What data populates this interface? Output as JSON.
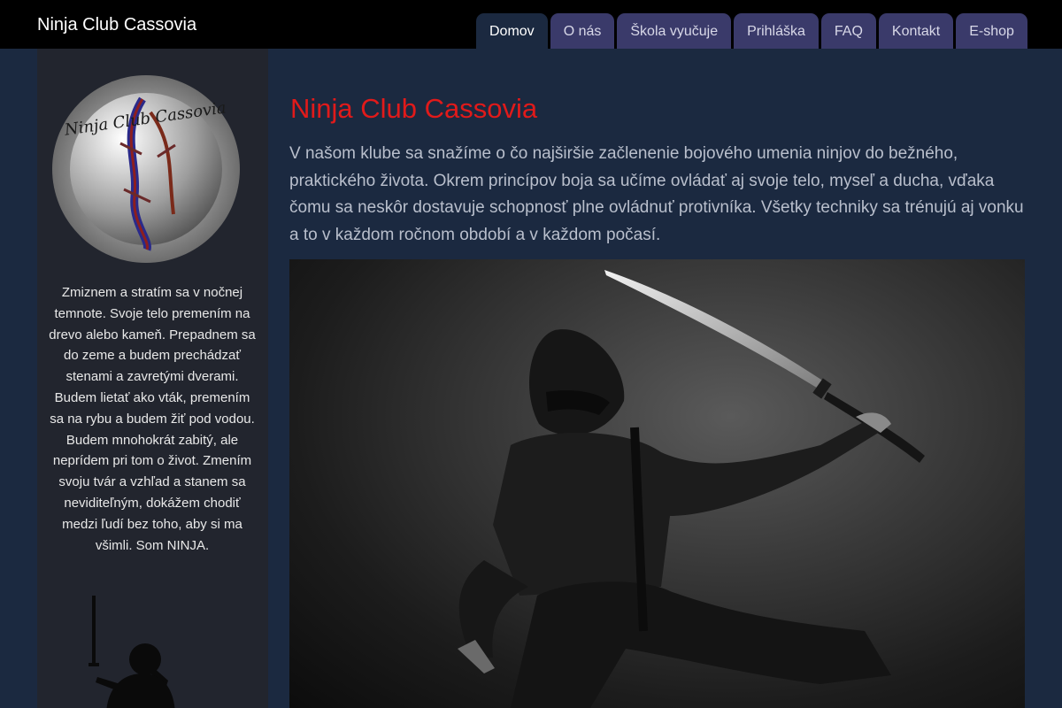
{
  "header": {
    "brand": "Ninja Club Cassovia",
    "tabs": [
      {
        "label": "Domov",
        "active": true
      },
      {
        "label": "O nás",
        "active": false
      },
      {
        "label": "Škola vyučuje",
        "active": false
      },
      {
        "label": "Prihláška",
        "active": false
      },
      {
        "label": "FAQ",
        "active": false
      },
      {
        "label": "Kontakt",
        "active": false
      },
      {
        "label": "E-shop",
        "active": false
      }
    ]
  },
  "sidebar": {
    "logo_text": "Ninja Club Cassovia",
    "quote": "Zmiznem a stratím sa v nočnej temnote. Svoje telo premením na drevo alebo kameň. Prepadnem sa do zeme a budem prechádzať stenami a zavretými dverami. Budem lietať ako vták, premením sa na rybu a budem žiť pod vodou. Budem mnohokrát zabitý, ale neprídem pri tom o život. Zmením svoju tvár a vzhľad a stanem sa neviditeľným, dokážem chodiť medzi ľudí bez toho, aby si ma všimli. Som NINJA."
  },
  "main": {
    "heading": "Ninja Club Cassovia",
    "intro": "V našom klube sa snažíme o čo najširšie začlenenie bojového umenia ninjov do bežného, praktického života. Okrem princípov boja sa učíme ovládať aj svoje telo, myseľ a ducha, vďaka čomu sa neskôr dostavuje schopnosť plne ovládnuť protivníka. Všetky techniky sa trénujú aj vonku a to v každom ročnom období a v každom počasí."
  },
  "colors": {
    "topbar": "#000000",
    "page_bg": "#1b2940",
    "tab_bg": "#3a3a6a",
    "heading": "#e11a1a",
    "sidebar_bg": "#22252e"
  },
  "icons": {
    "logo": "koi-fish-emblem",
    "photo": "ninja-with-katana",
    "silhouette": "ninja-silhouette"
  }
}
